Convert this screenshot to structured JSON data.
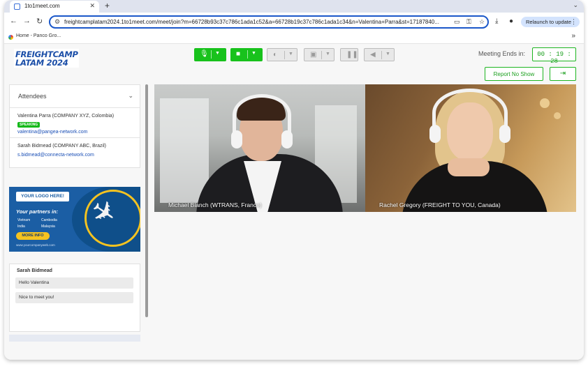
{
  "browser": {
    "tab_title": "1to1meet.com",
    "tab_close": "✕",
    "new_tab": "+",
    "tabs_chevron": "⌄",
    "back": "←",
    "forward": "→",
    "reload": "↻",
    "url": "freightcamplatam2024.1to1meet.com/meet/join?m=66728b93c37c786c1ada1c52&a=66728b19c37c786c1ada1c34&n=Valentina+Parra&st=17187840...",
    "relaunch_label": "Relaunch to update",
    "menu": "⋮",
    "bookmark_label": "Home - Panco Gro...",
    "bookmarks_more": "»"
  },
  "app": {
    "logo_line1": "FREIGHTCAMP",
    "logo_line2": "LATAM 2024",
    "meeting_label": "Meeting Ends in:",
    "timer": "00 : 19 : 28",
    "report_label": "Report No Show",
    "exit_icon": "⇥"
  },
  "attendees": {
    "title": "Attendees",
    "chevron": "⌄",
    "list": [
      {
        "name": "Valentina Parra (COMPANY XYZ, Colombia)",
        "badge": "SPEAKING",
        "email": "valentina@pangea-network.com"
      },
      {
        "name": "Sarah Bidmead (COMPANY ABC, Brazil)",
        "email": "s.bidmead@connecta-network.com"
      }
    ]
  },
  "ad": {
    "logo_button": "YOUR LOGO HERE!",
    "partners": "Your partners in:",
    "countries": [
      "Vietnam",
      "Cambodia",
      "India",
      "Malaysia"
    ],
    "more_info": "MORE INFO",
    "website": "www.yourcompanyweb.com"
  },
  "chat": {
    "sender": "Sarah Bidmead",
    "messages": [
      "Hello Valentina",
      "Nice to meet you!"
    ]
  },
  "videos": [
    {
      "label": "Michael Blanch (WTRANS, France)"
    },
    {
      "label": "Rachel Gregory (FREIGHT TO YOU, Canada)"
    }
  ],
  "colors": {
    "accent_green": "#18c21c",
    "link_blue": "#1a4fb6",
    "logo_blue": "#1c4fa8"
  },
  "icons": {
    "mic": "mic-icon",
    "camera": "camera-icon",
    "contrast": "contrast-icon",
    "screen_share": "screen-share-icon",
    "pause": "pause-icon",
    "volume": "volume-icon"
  }
}
